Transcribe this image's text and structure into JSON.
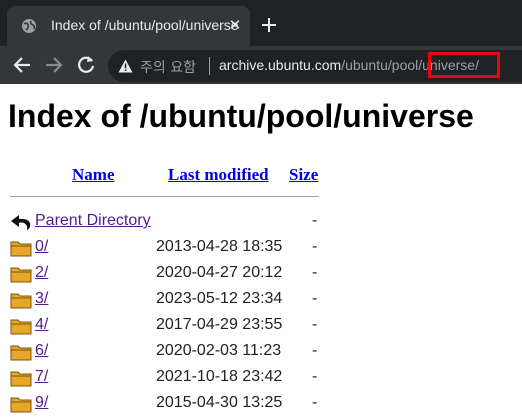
{
  "tab": {
    "title": "Index of /ubuntu/pool/universe",
    "favicon": "globe-icon",
    "close": "✕"
  },
  "toolbar": {
    "back_icon": "arrow-left-icon",
    "forward_icon": "arrow-right-icon",
    "reload_icon": "reload-icon",
    "security_label": "주의 요함",
    "url_host": "archive.ubuntu.com",
    "url_path": "/ubuntu/pool/universe/"
  },
  "page": {
    "title": "Index of /ubuntu/pool/universe",
    "columns": {
      "name": "Name",
      "modified": "Last modified",
      "size": "Size"
    },
    "parent": {
      "name": "Parent Directory",
      "size": "-"
    },
    "entries": [
      {
        "name": "0/",
        "modified": "2013-04-28 18:35",
        "size": "-"
      },
      {
        "name": "2/",
        "modified": "2020-04-27 20:12",
        "size": "-"
      },
      {
        "name": "3/",
        "modified": "2023-05-12 23:34",
        "size": "-"
      },
      {
        "name": "4/",
        "modified": "2017-04-29 23:55",
        "size": "-"
      },
      {
        "name": "6/",
        "modified": "2020-02-03 11:23",
        "size": "-"
      },
      {
        "name": "7/",
        "modified": "2021-10-18 23:42",
        "size": "-"
      },
      {
        "name": "9/",
        "modified": "2015-04-30 13:25",
        "size": "-"
      }
    ]
  },
  "colors": {
    "highlight": "#e8060b",
    "link": "#0000ee",
    "visited": "#551a8b"
  }
}
